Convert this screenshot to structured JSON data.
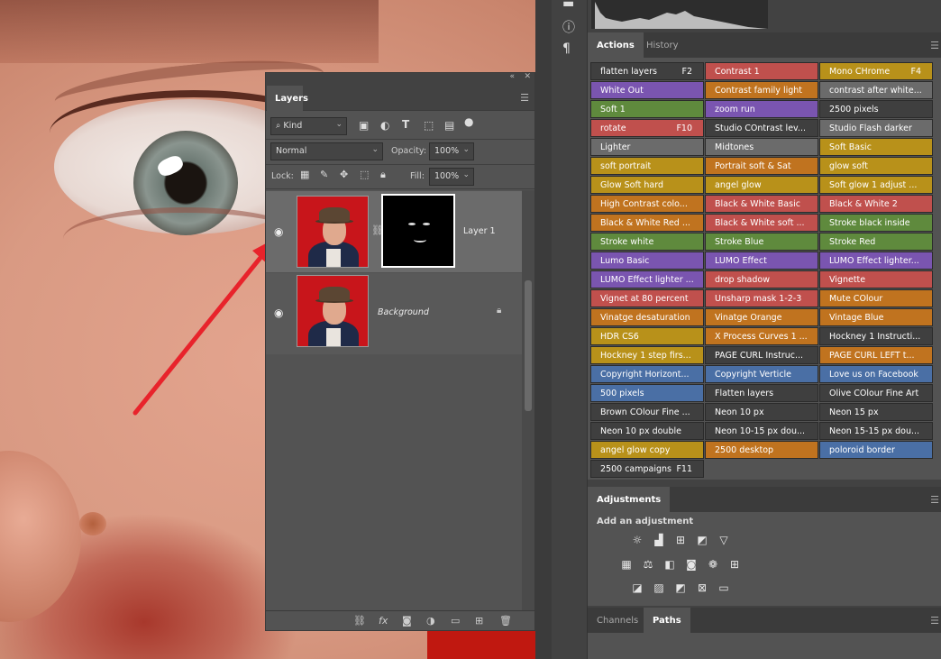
{
  "layers_panel": {
    "title": "Layers",
    "filter_label": "Kind",
    "blend_mode": "Normal",
    "opacity_label": "Opacity:",
    "opacity_value": "100%",
    "lock_label": "Lock:",
    "fill_label": "Fill:",
    "fill_value": "100%",
    "layers": [
      {
        "name": "Layer 1",
        "visible": true,
        "has_mask": true,
        "selected": true
      },
      {
        "name": "Background",
        "visible": true,
        "locked": true,
        "selected": false
      }
    ],
    "footer_icons": [
      "link-icon",
      "fx-icon",
      "mask-icon",
      "adjustment-icon",
      "folder-icon",
      "new-layer-icon",
      "trash-icon"
    ]
  },
  "actions_panel": {
    "tabs": [
      "Actions",
      "History"
    ],
    "active_tab": "Actions",
    "colors": {
      "gray": "#3f3f3f",
      "red": "#c0504d",
      "orange": "#c0731f",
      "yellow": "#b8911a",
      "green": "#5f8a3d",
      "blue": "#4a6fa5",
      "violet": "#7a55b0",
      "lightgray": "#6b6b6b"
    },
    "buttons": [
      {
        "label": "flatten layers",
        "key": "F2",
        "color": "#3f3f3f"
      },
      {
        "label": "Contrast 1",
        "key": "",
        "color": "#c0504d"
      },
      {
        "label": "Mono CHrome",
        "key": "F4",
        "color": "#b8911a"
      },
      {
        "label": "White Out",
        "key": "",
        "color": "#7a55b0"
      },
      {
        "label": "Contrast family light",
        "key": "",
        "color": "#c0731f"
      },
      {
        "label": "contrast after white...",
        "key": "",
        "color": "#6b6b6b"
      },
      {
        "label": "Soft 1",
        "key": "",
        "color": "#5f8a3d"
      },
      {
        "label": "zoom run",
        "key": "",
        "color": "#7a55b0"
      },
      {
        "label": "2500 pixels",
        "key": "",
        "color": "#3f3f3f"
      },
      {
        "label": "rotate",
        "key": "F10",
        "color": "#c0504d"
      },
      {
        "label": "Studio COntrast lev...",
        "key": "",
        "color": "#3f3f3f"
      },
      {
        "label": "Studio Flash darker",
        "key": "",
        "color": "#6b6b6b"
      },
      {
        "label": "Lighter",
        "key": "",
        "color": "#6b6b6b"
      },
      {
        "label": "Midtones",
        "key": "",
        "color": "#6b6b6b"
      },
      {
        "label": "Soft Basic",
        "key": "",
        "color": "#b8911a"
      },
      {
        "label": "soft portrait",
        "key": "",
        "color": "#b8911a"
      },
      {
        "label": "Portrait soft & Sat",
        "key": "",
        "color": "#c0731f"
      },
      {
        "label": "glow soft",
        "key": "",
        "color": "#b8911a"
      },
      {
        "label": "Glow Soft hard",
        "key": "",
        "color": "#b8911a"
      },
      {
        "label": "angel glow",
        "key": "",
        "color": "#b8911a"
      },
      {
        "label": "Soft glow 1 adjust ...",
        "key": "",
        "color": "#b8911a"
      },
      {
        "label": "High Contrast colo...",
        "key": "",
        "color": "#c0731f"
      },
      {
        "label": "Black & White Basic",
        "key": "",
        "color": "#c0504d"
      },
      {
        "label": "Black & White 2",
        "key": "",
        "color": "#c0504d"
      },
      {
        "label": "Black & White Red ...",
        "key": "",
        "color": "#c0731f"
      },
      {
        "label": "Black & White soft ...",
        "key": "",
        "color": "#c0504d"
      },
      {
        "label": "Stroke black inside",
        "key": "",
        "color": "#5f8a3d"
      },
      {
        "label": "Stroke white",
        "key": "",
        "color": "#5f8a3d"
      },
      {
        "label": "Stroke Blue",
        "key": "",
        "color": "#5f8a3d"
      },
      {
        "label": "Stroke Red",
        "key": "",
        "color": "#5f8a3d"
      },
      {
        "label": "Lumo Basic",
        "key": "",
        "color": "#7a55b0"
      },
      {
        "label": "LUMO Effect",
        "key": "",
        "color": "#7a55b0"
      },
      {
        "label": "LUMO Effect lighter...",
        "key": "",
        "color": "#7a55b0"
      },
      {
        "label": "LUMO Effect lighter ...",
        "key": "",
        "color": "#7a55b0"
      },
      {
        "label": "drop shadow",
        "key": "",
        "color": "#c0504d"
      },
      {
        "label": "Vignette",
        "key": "",
        "color": "#c0504d"
      },
      {
        "label": "Vignet at 80 percent",
        "key": "",
        "color": "#c0504d"
      },
      {
        "label": "Unsharp mask 1-2-3",
        "key": "",
        "color": "#c0504d"
      },
      {
        "label": "Mute COlour",
        "key": "",
        "color": "#c0731f"
      },
      {
        "label": "Vinatge desaturation",
        "key": "",
        "color": "#c0731f"
      },
      {
        "label": "Vinatge Orange",
        "key": "",
        "color": "#c0731f"
      },
      {
        "label": "Vintage Blue",
        "key": "",
        "color": "#c0731f"
      },
      {
        "label": "HDR CS6",
        "key": "",
        "color": "#b8911a"
      },
      {
        "label": "X Process Curves 1 ...",
        "key": "",
        "color": "#c0731f"
      },
      {
        "label": "Hockney 1 Instructi...",
        "key": "",
        "color": "#3f3f3f"
      },
      {
        "label": "Hockney 1 step firs...",
        "key": "",
        "color": "#b8911a"
      },
      {
        "label": "PAGE CURL Instruc...",
        "key": "",
        "color": "#3f3f3f"
      },
      {
        "label": "PAGE CURL LEFT t...",
        "key": "",
        "color": "#c0731f"
      },
      {
        "label": "Copyright Horizont...",
        "key": "",
        "color": "#4a6fa5"
      },
      {
        "label": "Copyright Verticle",
        "key": "",
        "color": "#4a6fa5"
      },
      {
        "label": "Love us on Facebook",
        "key": "",
        "color": "#4a6fa5"
      },
      {
        "label": "500 pixels",
        "key": "",
        "color": "#4a6fa5"
      },
      {
        "label": "Flatten layers",
        "key": "",
        "color": "#3f3f3f"
      },
      {
        "label": "Olive COlour Fine Art",
        "key": "",
        "color": "#3f3f3f"
      },
      {
        "label": "Brown COlour Fine ...",
        "key": "",
        "color": "#3f3f3f"
      },
      {
        "label": "Neon 10 px",
        "key": "",
        "color": "#3f3f3f"
      },
      {
        "label": "Neon 15 px",
        "key": "",
        "color": "#3f3f3f"
      },
      {
        "label": "Neon 10 px double",
        "key": "",
        "color": "#3f3f3f"
      },
      {
        "label": "Neon 10-15 px dou...",
        "key": "",
        "color": "#3f3f3f"
      },
      {
        "label": "Neon 15-15 px dou...",
        "key": "",
        "color": "#3f3f3f"
      },
      {
        "label": "angel glow copy",
        "key": "",
        "color": "#b8911a"
      },
      {
        "label": "2500 desktop",
        "key": "",
        "color": "#c0731f"
      },
      {
        "label": "poloroid border",
        "key": "",
        "color": "#4a6fa5"
      },
      {
        "label": "2500 campaigns",
        "key": "F11",
        "color": "#3f3f3f"
      }
    ]
  },
  "adjustments_panel": {
    "tab": "Adjustments",
    "title": "Add an adjustment",
    "icons": [
      [
        "brightness-icon",
        "levels-icon",
        "curves-icon",
        "exposure-icon",
        "vibrance-icon"
      ],
      [
        "hue-saturation-icon",
        "color-balance-icon",
        "black-white-icon",
        "photo-filter-icon",
        "channel-mixer-icon",
        "color-lookup-icon"
      ],
      [
        "invert-icon",
        "posterize-icon",
        "threshold-icon",
        "selective-color-icon",
        "gradient-map-icon"
      ]
    ]
  },
  "paths_panel": {
    "tabs": [
      "Channels",
      "Paths"
    ],
    "active_tab": "Paths"
  }
}
